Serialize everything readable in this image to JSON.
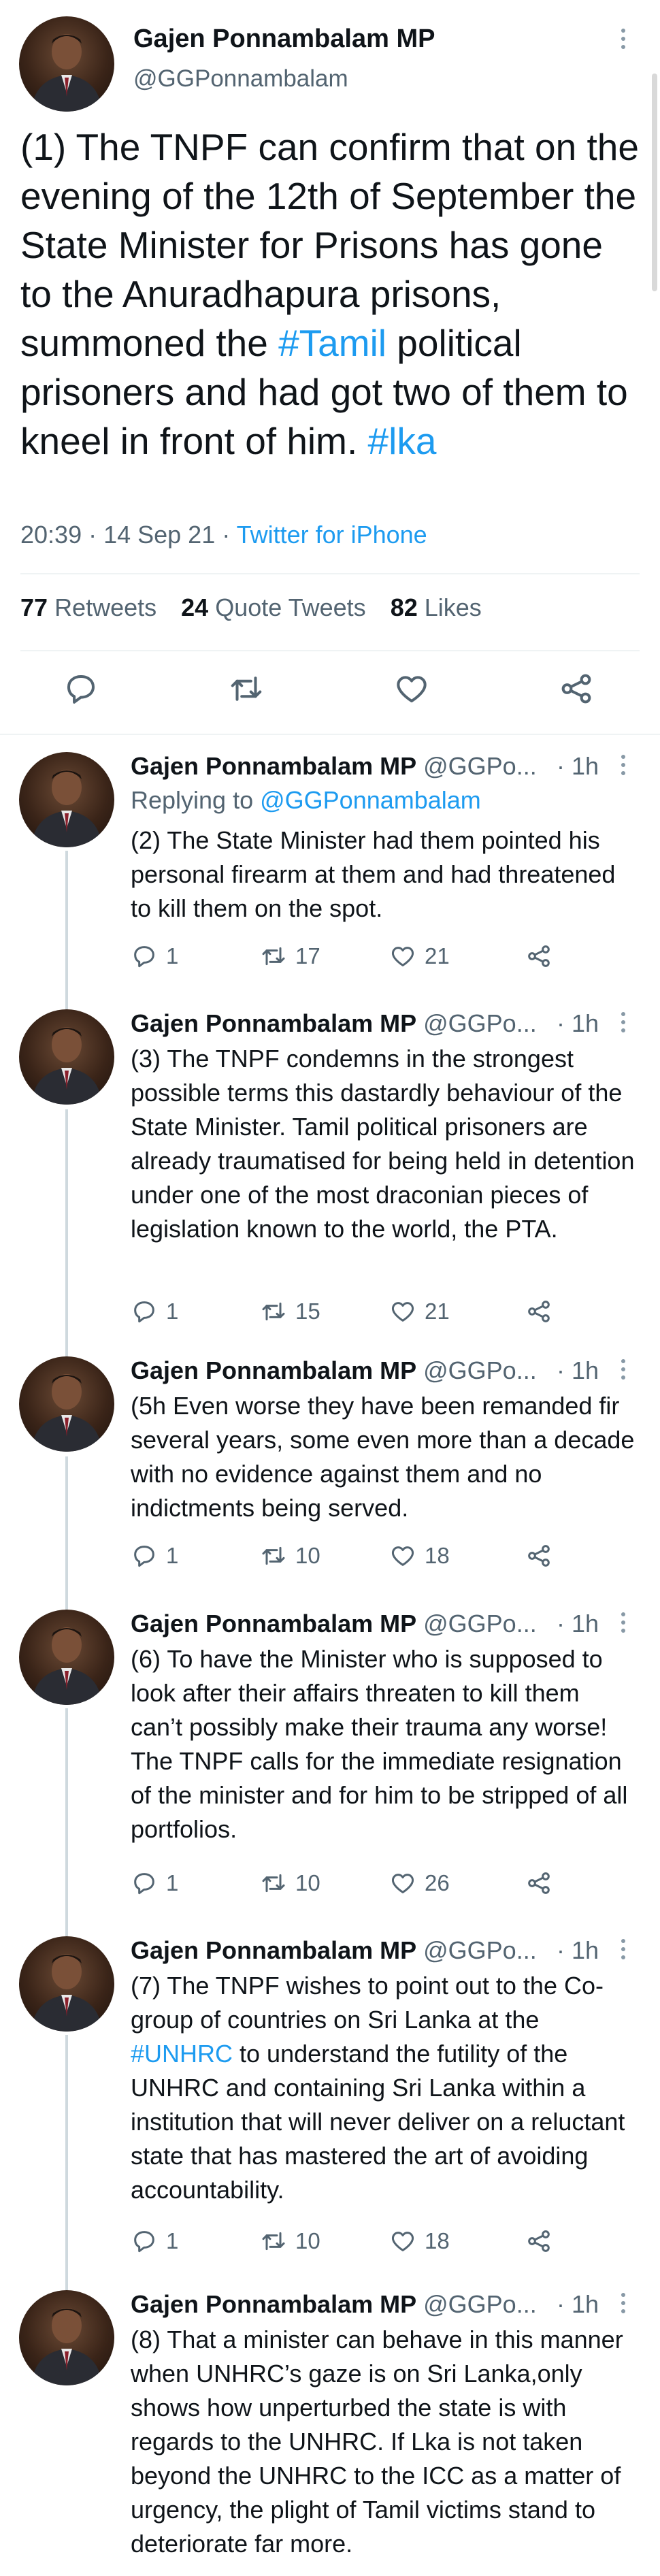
{
  "main_tweet": {
    "author_name": "Gajen Ponnambalam MP",
    "author_handle": "@GGPonnambalam",
    "text_parts": [
      "(1) The TNPF can confirm that on the evening of the 12th of September the State Minister for Prisons has gone to the Anuradhapura prisons, summoned the ",
      "#Tamil",
      " political prisoners and had got two of them to kneel in front of him. ",
      "#lka"
    ],
    "timestamp": "20:39 · 14 Sep 21 · ",
    "source": "Twitter for iPhone",
    "retweets_count": "77",
    "retweets_label": "Retweets",
    "quote_count": "24",
    "quote_label": "Quote Tweets",
    "likes_count": "82",
    "likes_label": "Likes",
    "icons": [
      "reply-icon",
      "retweet-icon",
      "like-icon",
      "share-icon"
    ]
  },
  "replies": [
    {
      "author_name": "Gajen Ponnambalam MP",
      "author_handle": "@GGPo...",
      "time": "· 1h",
      "replying_prefix": "Replying to ",
      "replying_to": "@GGPonnambalam",
      "text": "(2) The State Minister had them pointed his personal firearm at them and had threatened to kill them on the spot.",
      "replies": "1",
      "retweets": "17",
      "likes": "21"
    },
    {
      "author_name": "Gajen Ponnambalam MP",
      "author_handle": "@GGPo...",
      "time": "· 1h",
      "text": "(3) The TNPF condemns in the strongest possible terms this dastardly behaviour of the State Minister. Tamil political prisoners are already traumatised for being held in detention under one of the most draconian pieces of legislation known to the world, the PTA.",
      "replies": "1",
      "retweets": "15",
      "likes": "21"
    },
    {
      "author_name": "Gajen Ponnambalam MP",
      "author_handle": "@GGPo...",
      "time": "· 1h",
      "text": "(5h Even worse they have been remanded fir several years, some even more than a decade with no evidence against them and no indictments being served.",
      "replies": "1",
      "retweets": "10",
      "likes": "18"
    },
    {
      "author_name": "Gajen Ponnambalam MP",
      "author_handle": "@GGPo...",
      "time": "· 1h",
      "text": "(6) To have the Minister who is supposed to look after their affairs threaten to kill them can’t possibly make their trauma any worse! The TNPF calls for the immediate resignation of the minister and for him to be stripped of all portfolios.",
      "replies": "1",
      "retweets": "10",
      "likes": "26"
    },
    {
      "author_name": "Gajen Ponnambalam MP",
      "author_handle": "@GGPo...",
      "time": "· 1h",
      "text_parts": [
        "(7) The TNPF wishes to point out to the Co-group of countries on Sri Lanka at the ",
        "#UNHRC",
        " to understand the futility of the UNHRC and containing Sri Lanka within a institution that will never deliver on a reluctant state that has mastered the art of avoiding accountability."
      ],
      "replies": "1",
      "retweets": "10",
      "likes": "18"
    },
    {
      "author_name": "Gajen Ponnambalam MP",
      "author_handle": "@GGPo...",
      "time": "· 1h",
      "text": "(8) That a minister can behave in this manner when UNHRC’s gaze is on Sri Lanka,only shows how unperturbed the state is with regards to the UNHRC. If Lka is not taken beyond the UNHRC to the ICC as a matter of urgency, the plight of Tamil victims stand to deteriorate far more."
    }
  ],
  "colors": {
    "link": "#1d9bf0",
    "secondary_text": "#536471",
    "thread_line": "#cfd9de"
  }
}
